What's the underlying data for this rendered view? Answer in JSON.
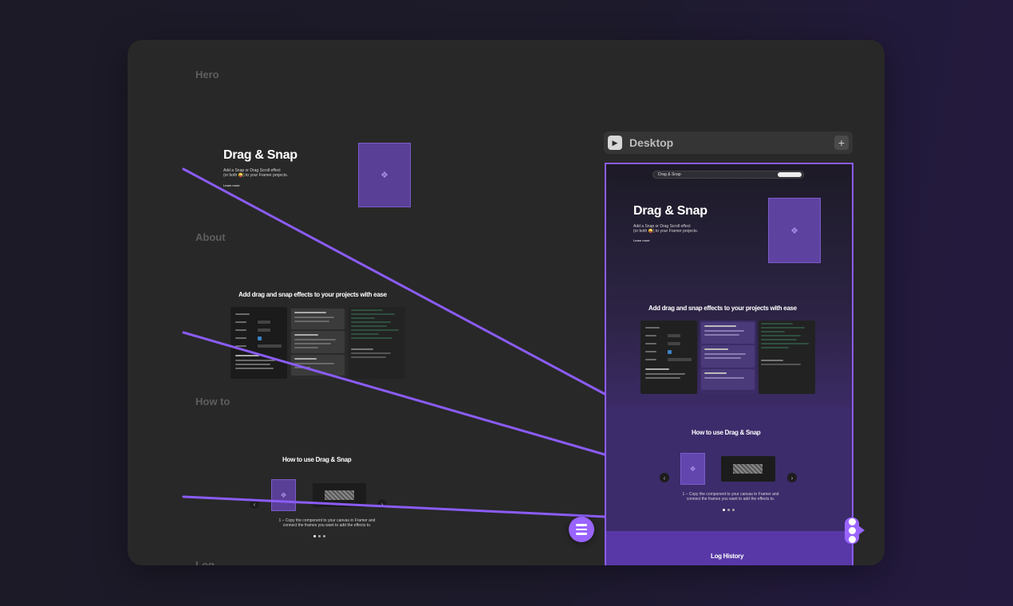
{
  "sections": {
    "hero": "Hero",
    "about": "About",
    "how_to": "How to",
    "log": "Log"
  },
  "hero": {
    "title": "Drag & Snap",
    "subtitle_line1": "Add a Snap or Drag Scroll effect",
    "subtitle_line2": "(or both 😜) to your Framer projects.",
    "link": "Learn more"
  },
  "about": {
    "title": "Add drag and snap effects to your projects with ease",
    "card_titles": [
      "Properties",
      "Independent property control",
      "Infer the controls",
      "Responsive",
      "Effortless effects",
      "Efficiency"
    ]
  },
  "howto": {
    "title": "How to use Drag & Snap",
    "caption_line1": "1 – Copy the component to your canvas in Framer and",
    "caption_line2": "connect the frames you want to add the effects to."
  },
  "frame": {
    "title": "Desktop",
    "nav_text": "Drag & Snap",
    "log_title": "Log History"
  },
  "icons": {
    "play": "play-icon",
    "plus": "plus-icon",
    "menu": "menu-icon",
    "handle": "connect-handle-icon",
    "component": "component-icon"
  },
  "colors": {
    "accent": "#9a64ff",
    "canvas": "#282828",
    "placeholder": "#5a3f96"
  }
}
